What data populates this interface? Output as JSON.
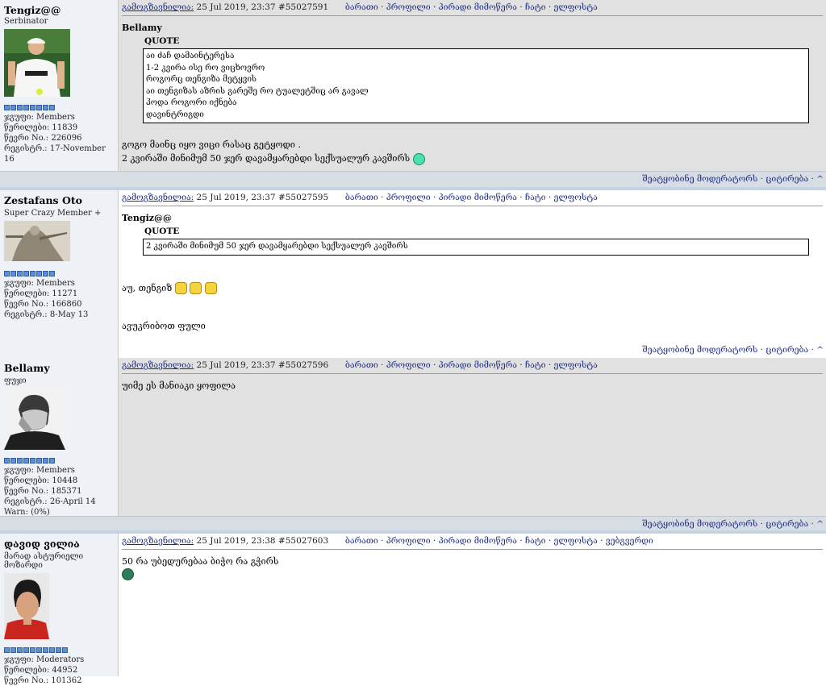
{
  "posts": [
    {
      "name": "Tengiz@@",
      "title": "Serbinator",
      "pips": 8,
      "group": "ჯგუფი: Members",
      "posts_count": "წერილები: 11839",
      "member_no": "წევრი No.: 226096",
      "registered": "რეგისტრ.: 17-November 16",
      "date_label": "გამოგზავნილია:",
      "date": "25 Jul 2019, 23:37",
      "post_id": "#55027591",
      "actions": [
        "ბარათი",
        "პროფილი",
        "პირადი მიმოწერა",
        "ჩატი",
        "ელფოსტა"
      ],
      "quote_author": "Bellamy",
      "quote_label": "QUOTE",
      "quote_lines": [
        "აი ძაჩ დამაინტერესა",
        "1-2 კვირა ისე რო ვიცხოვრო",
        "როგორც თენგიზა მეტყვის",
        "აი თენგიზას აზრის გარეშე რო ტუალეტშიც არ გავალ",
        "ჰოდა როგორი იქნება",
        "დავინტრიგდი"
      ],
      "text_lines": [
        "გოგო მაინც იყო ვიცი რასაც გეტყოდი .",
        "2 კვირაში მინიმუმ 50 ჯერ დავამყარებდი სექსუალურ კავშირს"
      ],
      "footer": "შეატყობინე მოდერატორს  · ციტირება · ^"
    },
    {
      "name": "Zestafans Oto",
      "title": "Super Crazy Member +",
      "pips": 8,
      "group": "ჯგუფი: Members",
      "posts_count": "წერილები: 11271",
      "member_no": "წევრი No.: 166860",
      "registered": "რეგისტრ.: 8-May 13",
      "date_label": "გამოგზავნილია:",
      "date": "25 Jul 2019, 23:37",
      "post_id": "#55027595",
      "actions": [
        "ბარათი",
        "პროფილი",
        "პირადი მიმოწერა",
        "ჩატი",
        "ელფოსტა"
      ],
      "quote_author": "Tengiz@@",
      "quote_label": "QUOTE",
      "quote_lines": [
        "2 კვირაში მინიმუმ 50 ჯერ დავამყარებდი სექსუალურ კავშირს"
      ],
      "text_lines": [
        "აუ, თენგიზ",
        "ავუკრიბოთ ფული"
      ],
      "footer": "შეატყობინე მოდერატორს  · ციტირება · ^"
    },
    {
      "name": "Bellamy",
      "title": "ფუჯი",
      "pips": 8,
      "group": "ჯგუფი: Members",
      "posts_count": "წერილები: 10448",
      "member_no": "წევრი No.: 185371",
      "registered": "რეგისტრ.: 26-April 14",
      "warn": "Warn: (0%)",
      "date_label": "გამოგზავნილია:",
      "date": "25 Jul 2019, 23:37",
      "post_id": "#55027596",
      "actions": [
        "ბარათი",
        "პროფილი",
        "პირადი მიმოწერა",
        "ჩატი",
        "ელფოსტა"
      ],
      "text_lines": [
        "უიმე ეს მანიაკი ყოფილა"
      ],
      "footer": "შეატყობინე მოდერატორს  · ციტირება · ^"
    },
    {
      "name": "დავიდ ვილია",
      "title": "მარად ასტურიელი მოზარდი",
      "pips": 10,
      "group": "ჯგუფი: Moderators",
      "posts_count": "წერილები: 44952",
      "member_no": "წევრი No.: 101362",
      "date_label": "გამოგზავნილია:",
      "date": "25 Jul 2019, 23:38",
      "post_id": "#55027603",
      "actions": [
        "ბარათი",
        "პროფილი",
        "პირადი მიმოწერა",
        "ჩატი",
        "ელფოსტა",
        "ვებგვერდი"
      ],
      "text_lines": [
        "50 რა უბედურებაა ბიჭო რა გჭირს"
      ]
    }
  ],
  "colors": {
    "post_bg_gray": "#e1e1e1",
    "author_bg": "#eef2f6",
    "link": "#1a2a80",
    "separator": "#c5d3e3",
    "pip": "#5b8fd6"
  }
}
